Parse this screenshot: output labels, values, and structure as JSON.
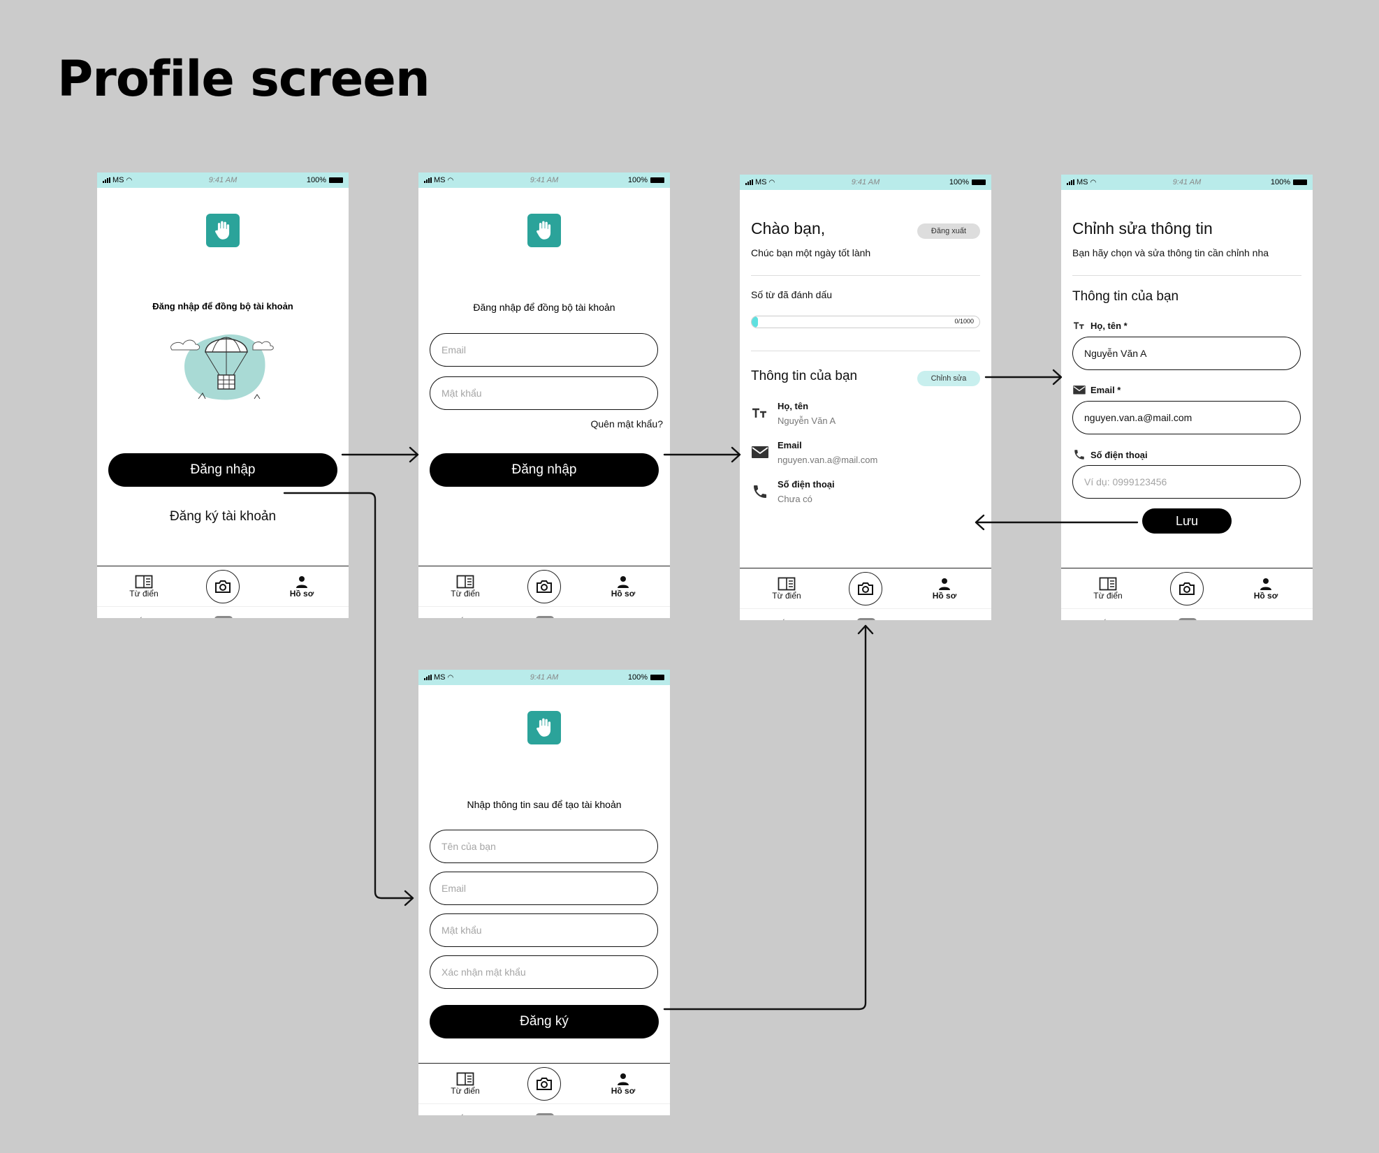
{
  "page_title": "Profile screen",
  "status_bar": {
    "carrier": "MS",
    "time": "9:41 AM",
    "battery": "100%"
  },
  "nav": {
    "dictionary": "Từ điển",
    "profile": "Hồ sơ"
  },
  "screen_login_intro": {
    "subtitle": "Đăng nhập để đồng bộ tài khoản",
    "login_button": "Đăng nhập",
    "register_link": "Đăng ký tài khoản"
  },
  "screen_login_form": {
    "subtitle": "Đăng nhập để đồng bộ tài khoản",
    "email_placeholder": "Email",
    "password_placeholder": "Mật khẩu",
    "forgot_password": "Quên mật khẩu?",
    "login_button": "Đăng nhập"
  },
  "screen_register": {
    "subtitle": "Nhập thông tin sau để tạo tài khoản",
    "name_placeholder": "Tên của bạn",
    "email_placeholder": "Email",
    "password_placeholder": "Mật khẩu",
    "confirm_placeholder": "Xác nhận mật khẩu",
    "register_button": "Đăng ký"
  },
  "screen_profile": {
    "greeting": "Chào bạn,",
    "wish": "Chúc bạn một ngày tốt lành",
    "logout": "Đăng xuất",
    "bookmarked_label": "Số từ đã đánh dấu",
    "progress_text": "0/1000",
    "progress_value": 0,
    "progress_max": 1000,
    "info_title": "Thông tin của bạn",
    "edit": "Chỉnh sửa",
    "name_label": "Họ, tên",
    "name_value": "Nguyễn Văn A",
    "email_label": "Email",
    "email_value": "nguyen.van.a@mail.com",
    "phone_label": "Số điện thoại",
    "phone_value": "Chưa có"
  },
  "screen_edit": {
    "title": "Chỉnh sửa thông tin",
    "subtitle": "Bạn hãy chọn và sửa thông tin cần chỉnh nha",
    "section_title": "Thông tin của bạn",
    "name_label": "Họ, tên *",
    "name_value": "Nguyễn Văn A",
    "email_label": "Email *",
    "email_value": "nguyen.van.a@mail.com",
    "phone_label": "Số điện thoại",
    "phone_placeholder": "Ví dụ: 0999123456",
    "save_button": "Lưu"
  },
  "colors": {
    "background": "#cbcbcb",
    "status_bar": "#b9ebea",
    "brand_teal": "#2ba39a",
    "chip": "#c8efee",
    "progress_fill": "#5fe0df"
  }
}
